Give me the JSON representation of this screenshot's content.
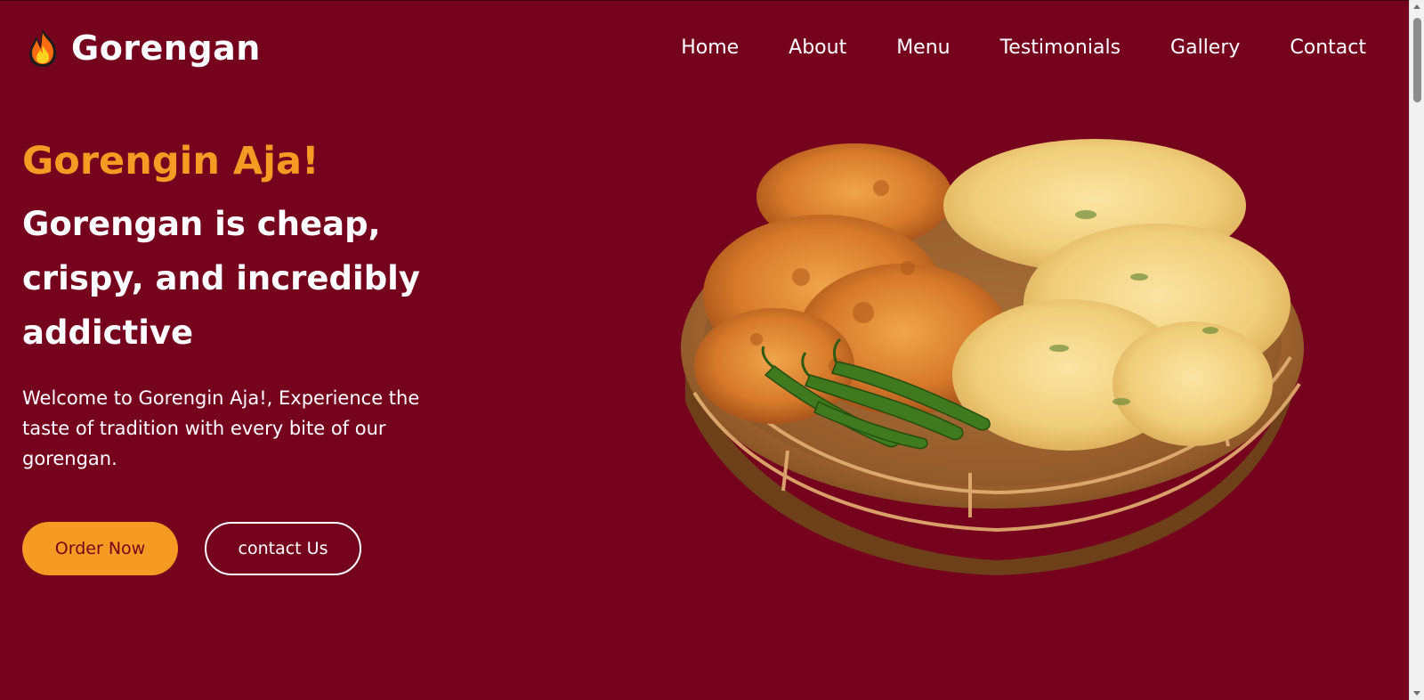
{
  "brand": {
    "name": "Gorengan",
    "icon": "fire-icon",
    "colors": {
      "background": "#76031e",
      "accent": "#f59a23",
      "text": "#ffffff"
    }
  },
  "nav": {
    "items": [
      {
        "label": "Home"
      },
      {
        "label": "About"
      },
      {
        "label": "Menu"
      },
      {
        "label": "Testimonials"
      },
      {
        "label": "Gallery"
      },
      {
        "label": "Contact"
      }
    ]
  },
  "hero": {
    "kicker": "Gorengin Aja!",
    "headline": "Gorengan is cheap, crispy, and incredibly addictive",
    "lead": "Welcome to Gorengin Aja!, Experience the taste of tradition with every bite of our gorengan.",
    "buttons": {
      "primary": "Order Now",
      "secondary": "contact Us"
    },
    "image_alt": "Basket of gorengan fritters with green chilies"
  }
}
